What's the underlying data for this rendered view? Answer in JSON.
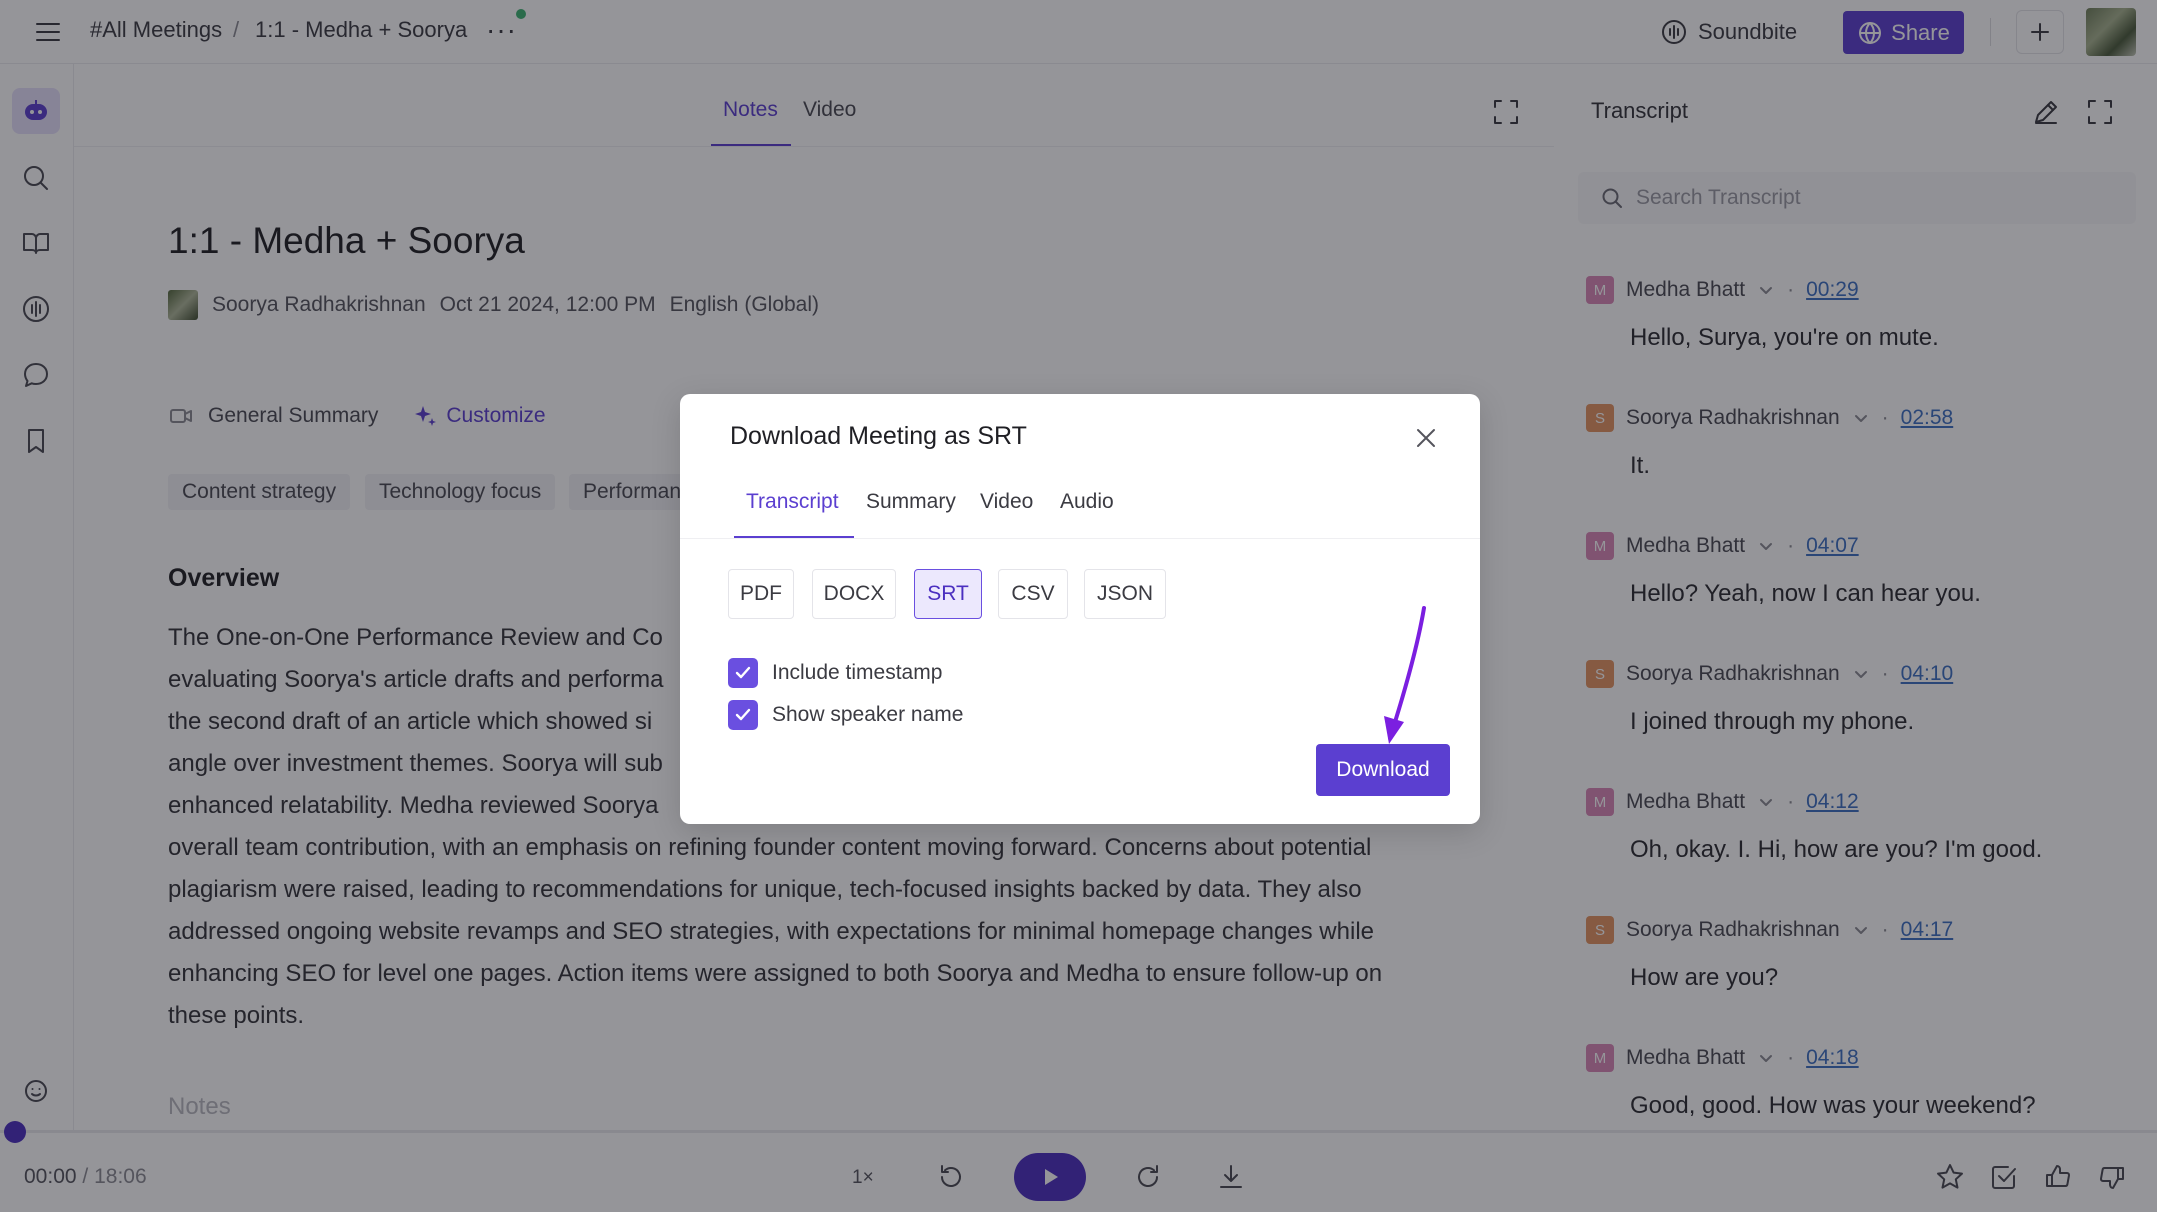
{
  "topbar": {
    "breadcrumb_root": "#All Meetings",
    "breadcrumb_sep": "/",
    "breadcrumb_current": "1:1 - Medha + Soorya",
    "more": "···",
    "soundbite_label": "Soundbite",
    "share_label": "Share"
  },
  "notes_view": {
    "tabs": [
      {
        "label": "Notes"
      },
      {
        "label": "Video"
      }
    ],
    "title": "1:1 - Medha + Soorya",
    "owner": "Soorya Radhakrishnan",
    "datetime": "Oct 21 2024, 12:00 PM",
    "language": "English (Global)",
    "summary_type": "General Summary",
    "customize_label": "Customize",
    "chips": [
      "Content strategy",
      "Technology focus",
      "Performan"
    ],
    "overview_heading": "Overview",
    "overview_lines": [
      "The One-on-One Performance Review and Co",
      "evaluating Soorya's article drafts and performa",
      "the second draft of an article which showed si",
      "angle over investment themes. Soorya will sub",
      "enhanced relatability. Medha reviewed Soorya",
      "overall team contribution, with an emphasis on refining founder content moving forward. Concerns about potential",
      "plagiarism were raised, leading to recommendations for unique, tech-focused insights backed by data. They also",
      "addressed ongoing website revamps and SEO strategies, with expectations for minimal homepage changes while",
      "enhancing SEO for level one pages. Action items were assigned to both Soorya and Medha to ensure follow-up on",
      "these points."
    ],
    "notes_label": "Notes"
  },
  "transcript": {
    "title": "Transcript",
    "search_placeholder": "Search Transcript",
    "entries": [
      {
        "initial": "M",
        "speaker": "Medha Bhatt",
        "time": "00:29",
        "text": "Hello, Surya, you're on mute."
      },
      {
        "initial": "S",
        "speaker": "Soorya Radhakrishnan",
        "time": "02:58",
        "text": "It."
      },
      {
        "initial": "M",
        "speaker": "Medha Bhatt",
        "time": "04:07",
        "text": "Hello? Yeah, now I can hear you."
      },
      {
        "initial": "S",
        "speaker": "Soorya Radhakrishnan",
        "time": "04:10",
        "text": "I joined through my phone."
      },
      {
        "initial": "M",
        "speaker": "Medha Bhatt",
        "time": "04:12",
        "text": "Oh, okay. I. Hi, how are you? I'm good."
      },
      {
        "initial": "S",
        "speaker": "Soorya Radhakrishnan",
        "time": "04:17",
        "text": "How are you?"
      },
      {
        "initial": "M",
        "speaker": "Medha Bhatt",
        "time": "04:18",
        "text": "Good, good. How was your weekend?"
      }
    ],
    "dot": "·"
  },
  "player": {
    "current_time": "00:00",
    "separator": "/",
    "duration": "18:06",
    "speed": "1×",
    "progress": 0
  },
  "modal": {
    "title": "Download Meeting as SRT",
    "tabs": [
      {
        "label": "Transcript"
      },
      {
        "label": "Summary"
      },
      {
        "label": "Video"
      },
      {
        "label": "Audio"
      }
    ],
    "formats": [
      "PDF",
      "DOCX",
      "SRT",
      "CSV",
      "JSON"
    ],
    "selected_format": "SRT",
    "include_timestamp_label": "Include timestamp",
    "show_speaker_label": "Show speaker name",
    "download_label": "Download"
  },
  "colors": {
    "accent": "#5b3fd0",
    "timestamp_link": "#3d6fc2",
    "speaker_m": "#d987b6",
    "speaker_s": "#e39462",
    "annotation_arrow": "#7b1fe0"
  },
  "icons": [
    "menu-icon",
    "soundbite-icon",
    "globe-icon",
    "plus-icon",
    "bot-icon",
    "search-icon",
    "book-icon",
    "waveform-icon",
    "chat-icon",
    "bookmark-icon",
    "smiley-icon",
    "expand-icon",
    "video-camera-icon",
    "sparkle-icon",
    "edit-icon",
    "chevron-down-icon",
    "rewind-icon",
    "play-icon",
    "forward-icon",
    "download-icon",
    "star-icon",
    "checkbox-icon",
    "thumbs-up-icon",
    "thumbs-down-icon",
    "close-icon",
    "check-icon",
    "arrow-annotation"
  ]
}
